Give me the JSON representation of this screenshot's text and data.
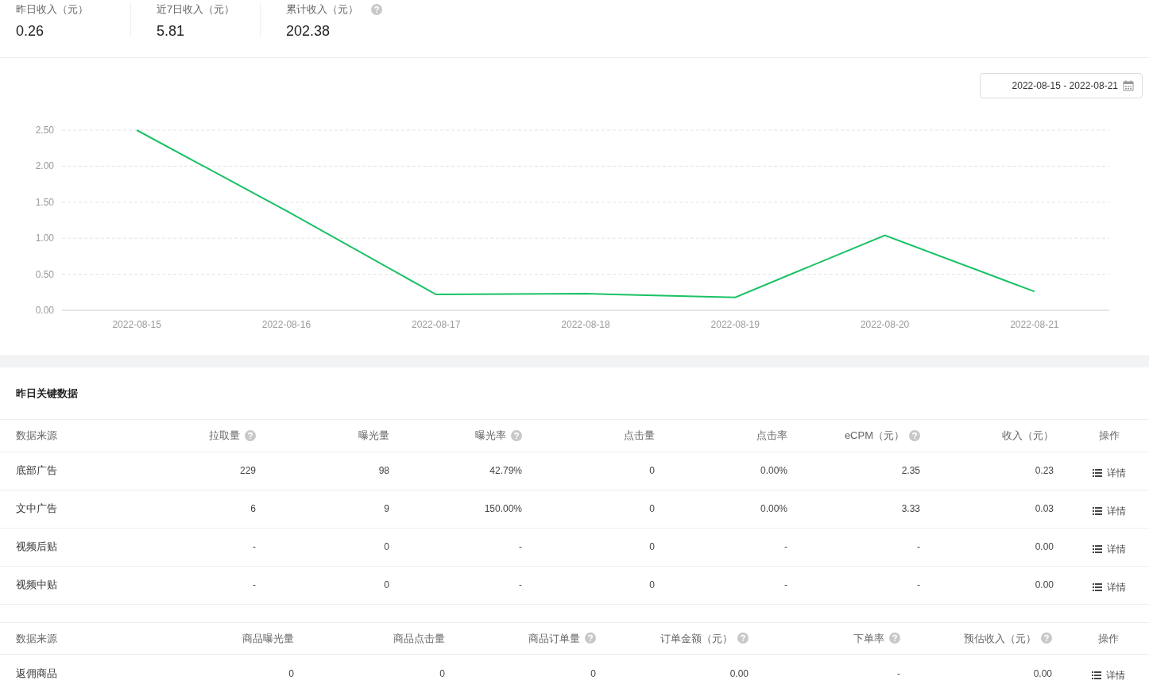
{
  "stats": [
    {
      "label": "昨日收入（元）",
      "value": "0.26",
      "help": false
    },
    {
      "label": "近7日收入（元）",
      "value": "5.81",
      "help": false
    },
    {
      "label": "累计收入（元）",
      "value": "202.38",
      "help": true
    }
  ],
  "date_range": "2022-08-15 - 2022-08-21",
  "chart": {
    "chart_data": {
      "type": "line",
      "categories": [
        "2022-08-15",
        "2022-08-16",
        "2022-08-17",
        "2022-08-18",
        "2022-08-19",
        "2022-08-20",
        "2022-08-21"
      ],
      "ylim": [
        0,
        2.5
      ],
      "yticks": [
        {
          "value": 0,
          "label": "0.00"
        },
        {
          "value": 0.5,
          "label": "0.50"
        },
        {
          "value": 1,
          "label": "1.00"
        },
        {
          "value": 1.5,
          "label": "1.50"
        },
        {
          "value": 2,
          "label": "2.00"
        },
        {
          "value": 2.5,
          "label": "2.50"
        }
      ],
      "grid": true,
      "series": [
        {
          "color": "#19c165",
          "values": [
            2.5,
            1.38,
            0.22,
            0.23,
            0.18,
            1.04,
            0.26
          ]
        }
      ]
    }
  },
  "section_title": "昨日关键数据",
  "tables": [
    {
      "columns": [
        {
          "label": "数据来源",
          "help": false
        },
        {
          "label": "拉取量",
          "help": true
        },
        {
          "label": "曝光量",
          "help": false
        },
        {
          "label": "曝光率",
          "help": true
        },
        {
          "label": "点击量",
          "help": false
        },
        {
          "label": "点击率",
          "help": false
        },
        {
          "label": "eCPM（元）",
          "help": true
        },
        {
          "label": "收入（元）",
          "help": false
        },
        {
          "label": "操作",
          "help": false
        }
      ],
      "rows": [
        {
          "cells": [
            "底部广告",
            "229",
            "98",
            "42.79%",
            "0",
            "0.00%",
            "2.35",
            "0.23"
          ],
          "action": "详情"
        },
        {
          "cells": [
            "文中广告",
            "6",
            "9",
            "150.00%",
            "0",
            "0.00%",
            "3.33",
            "0.03"
          ],
          "action": "详情"
        },
        {
          "cells": [
            "视频后贴",
            "-",
            "0",
            "-",
            "0",
            "-",
            "-",
            "0.00"
          ],
          "action": "详情"
        },
        {
          "cells": [
            "视频中贴",
            "-",
            "0",
            "-",
            "0",
            "-",
            "-",
            "0.00"
          ],
          "action": "详情"
        }
      ]
    },
    {
      "columns": [
        {
          "label": "数据来源",
          "help": false
        },
        {
          "label": "商品曝光量",
          "help": false
        },
        {
          "label": "商品点击量",
          "help": false
        },
        {
          "label": "商品订单量",
          "help": true
        },
        {
          "label": "订单金额（元）",
          "help": true
        },
        {
          "label": "下单率",
          "help": true
        },
        {
          "label": "预估收入（元）",
          "help": true
        },
        {
          "label": "操作",
          "help": false
        }
      ],
      "rows": [
        {
          "cells": [
            "返佣商品",
            "0",
            "0",
            "0",
            "0.00",
            "-",
            "0.00"
          ],
          "action": "详情"
        }
      ]
    }
  ]
}
